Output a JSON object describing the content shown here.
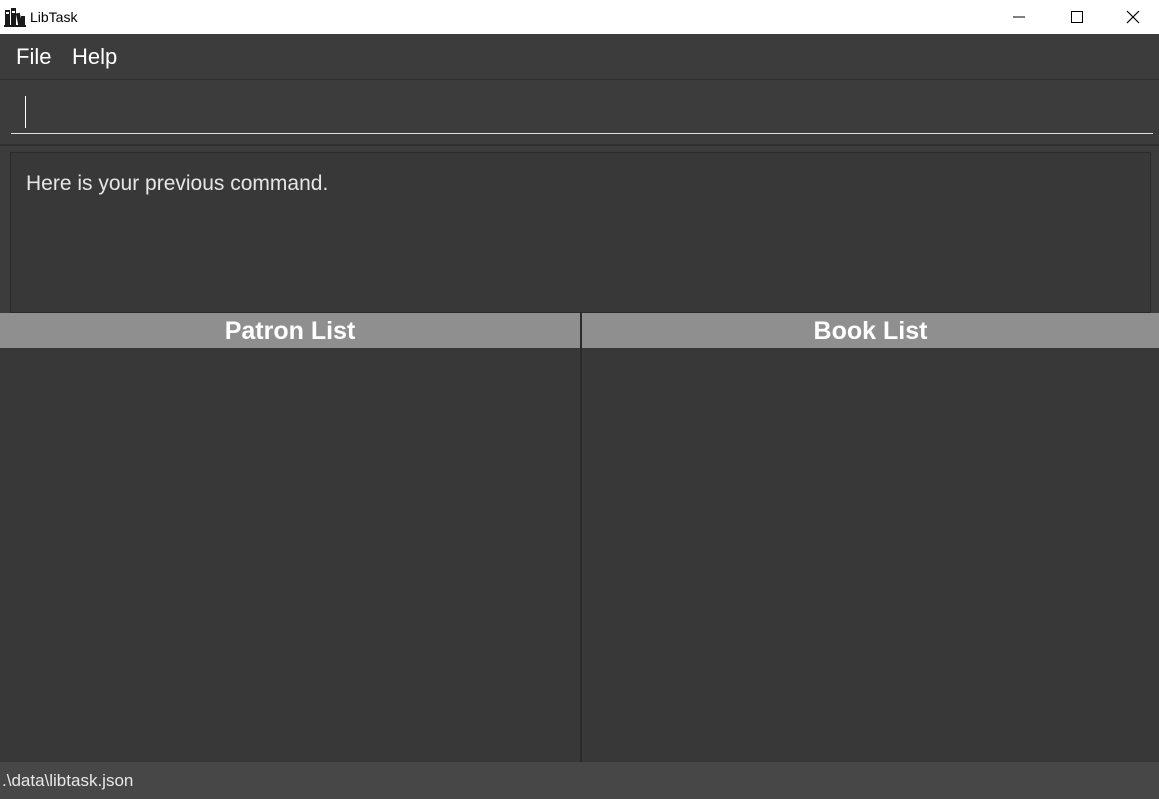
{
  "window": {
    "title": "LibTask",
    "icon": "books-icon",
    "controls": [
      "minimize-icon",
      "maximize-icon",
      "close-icon"
    ]
  },
  "menu": {
    "items": [
      {
        "label": "File"
      },
      {
        "label": "Help"
      }
    ]
  },
  "command_box": {
    "value": "",
    "placeholder": ""
  },
  "result_display": {
    "text": "Here is your previous command."
  },
  "patron_list": {
    "title": "Patron List",
    "items": []
  },
  "book_list": {
    "title": "Book List",
    "items": []
  },
  "status_bar": {
    "file_path": ".\\data\\libtask.json"
  },
  "colors": {
    "background": "#3c3c3c",
    "list_header": "#8f8f8f",
    "list_body": "#383838",
    "status_bar": "#474747",
    "titlebar": "#ffffff"
  }
}
